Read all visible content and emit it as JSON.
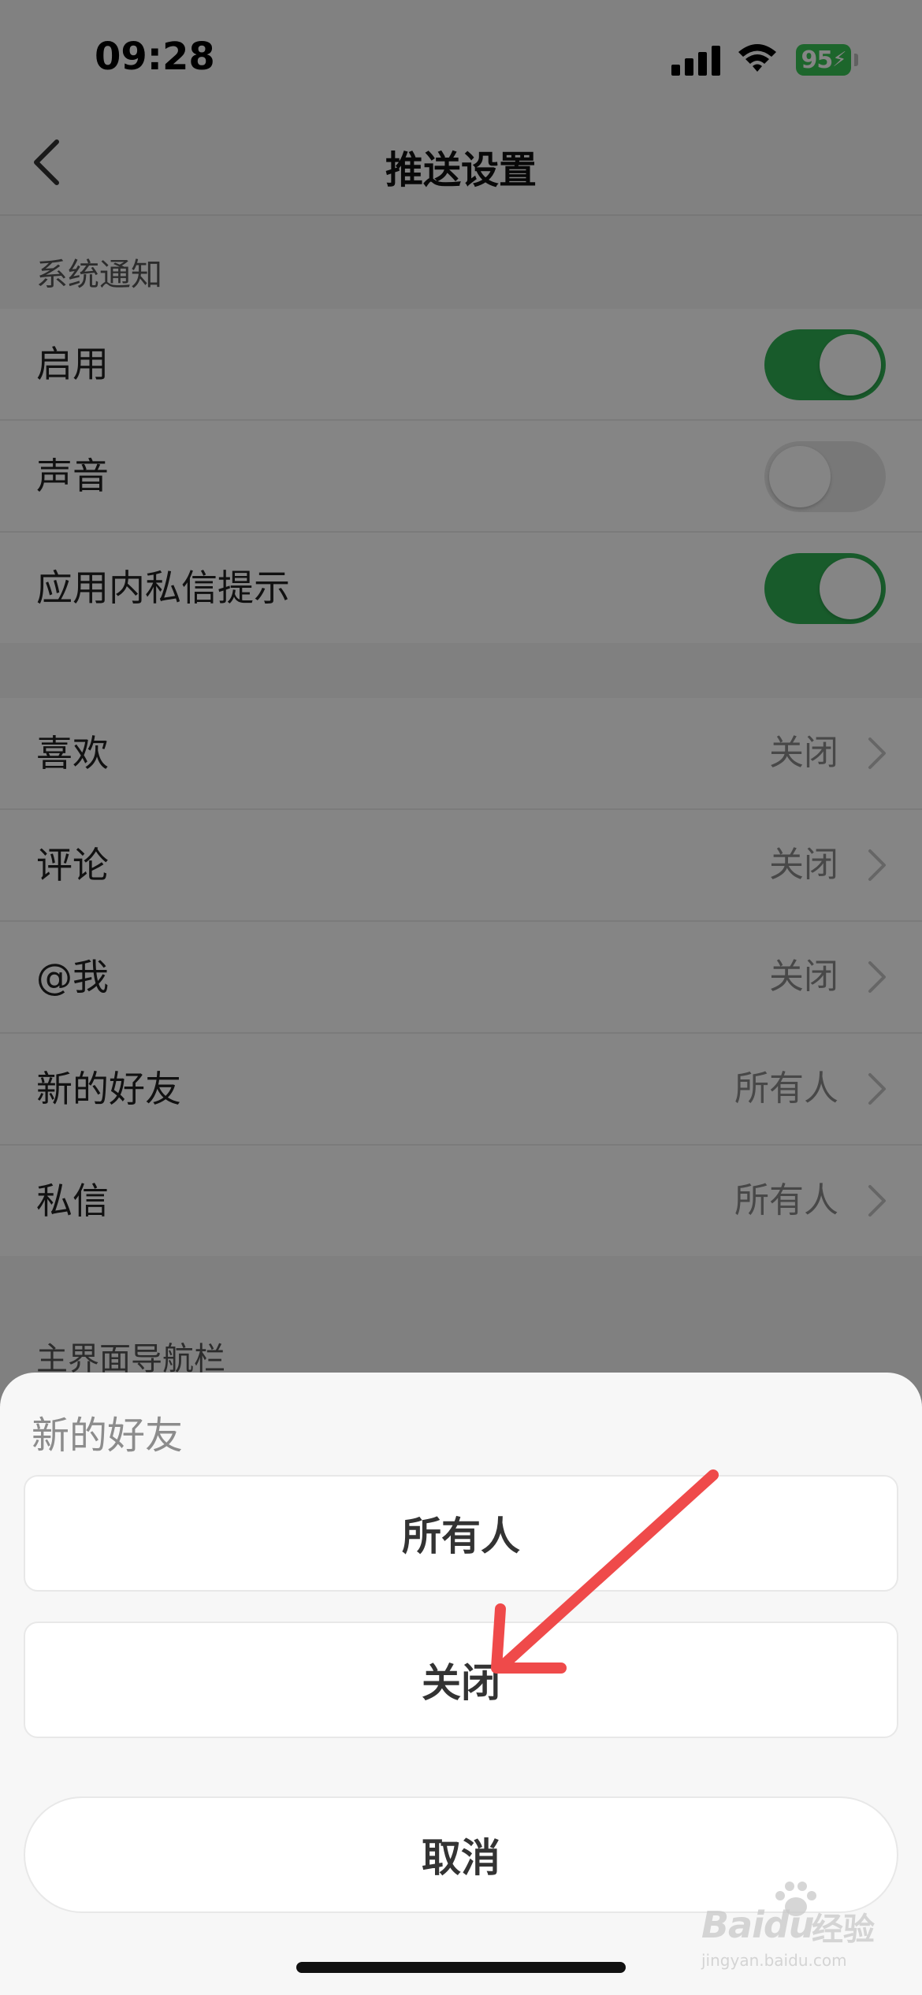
{
  "status_bar": {
    "time": "09:28",
    "battery": "95",
    "icons": [
      "signal-icon",
      "wifi-icon",
      "battery-charging-icon"
    ]
  },
  "nav": {
    "title": "推送设置",
    "back_icon": "chevron-left-icon"
  },
  "system_notifications": {
    "section_label": "系统通知",
    "rows": [
      {
        "label": "启用",
        "toggle": true
      },
      {
        "label": "声音",
        "toggle": false
      },
      {
        "label": "应用内私信提示",
        "toggle": true
      }
    ]
  },
  "notification_items": [
    {
      "label": "喜欢",
      "value": "关闭"
    },
    {
      "label": "评论",
      "value": "关闭"
    },
    {
      "label": "@我",
      "value": "关闭"
    },
    {
      "label": "新的好友",
      "value": "所有人"
    },
    {
      "label": "私信",
      "value": "所有人"
    }
  ],
  "nav_section_label": "主界面导航栏",
  "action_sheet": {
    "title": "新的好友",
    "options": [
      "所有人",
      "关闭"
    ],
    "cancel": "取消"
  },
  "colors": {
    "toggle_on": "#2fae53",
    "battery": "#39c455",
    "annotation_arrow": "#ef4a4a"
  },
  "watermark": {
    "brand": "Baidu",
    "brand_cn": "经验",
    "sub": "jingyan.baidu.com"
  }
}
